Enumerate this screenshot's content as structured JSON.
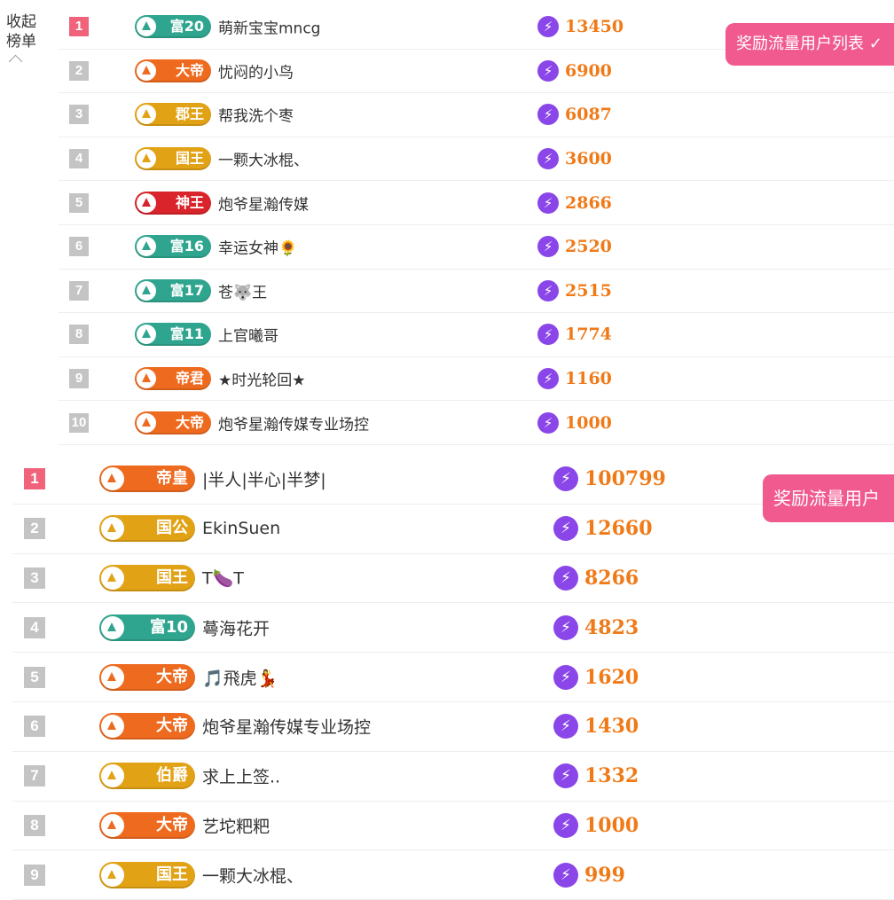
{
  "collapse": {
    "line1": "收起",
    "line2": "榜单"
  },
  "reward_buttons": [
    "奖励流量用户列表 ✓",
    "奖励流量用户"
  ],
  "list1": [
    {
      "rank": "1",
      "badge": "富20",
      "badge_color": "teal",
      "name": "萌新宝宝mncg",
      "score": "13450"
    },
    {
      "rank": "2",
      "badge": "大帝",
      "badge_color": "orange",
      "name": "忧闷的小鸟",
      "score": "6900"
    },
    {
      "rank": "3",
      "badge": "郡王",
      "badge_color": "gold",
      "name": "帮我洗个枣",
      "score": "6087"
    },
    {
      "rank": "4",
      "badge": "国王",
      "badge_color": "gold",
      "name": "一颗大冰棍、",
      "score": "3600"
    },
    {
      "rank": "5",
      "badge": "神王",
      "badge_color": "red",
      "name": "炮爷星瀚传媒",
      "score": "2866"
    },
    {
      "rank": "6",
      "badge": "富16",
      "badge_color": "teal",
      "name": "幸运女神🌻",
      "score": "2520"
    },
    {
      "rank": "7",
      "badge": "富17",
      "badge_color": "teal",
      "name": "苍🐺王",
      "score": "2515"
    },
    {
      "rank": "8",
      "badge": "富11",
      "badge_color": "teal",
      "name": "上官曦哥",
      "score": "1774"
    },
    {
      "rank": "9",
      "badge": "帝君",
      "badge_color": "orange",
      "name": "★时光轮回★",
      "score": "1160"
    },
    {
      "rank": "10",
      "badge": "大帝",
      "badge_color": "orange",
      "name": "炮爷星瀚传媒专业场控",
      "score": "1000"
    }
  ],
  "list2": [
    {
      "rank": "1",
      "badge": "帝皇",
      "badge_color": "orange",
      "name": "|半人|半心|半梦|",
      "score": "100799"
    },
    {
      "rank": "2",
      "badge": "国公",
      "badge_color": "gold",
      "name": "EkinSuen",
      "score": "12660"
    },
    {
      "rank": "3",
      "badge": "国王",
      "badge_color": "gold",
      "name": "T🍆T",
      "score": "8266"
    },
    {
      "rank": "4",
      "badge": "富10",
      "badge_color": "teal",
      "name": "蕚海花开",
      "score": "4823"
    },
    {
      "rank": "5",
      "badge": "大帝",
      "badge_color": "orange",
      "name": "🎵飛虎💃",
      "score": "1620"
    },
    {
      "rank": "6",
      "badge": "大帝",
      "badge_color": "orange",
      "name": "炮爷星瀚传媒专业场控",
      "score": "1430"
    },
    {
      "rank": "7",
      "badge": "伯爵",
      "badge_color": "gold",
      "name": "求上上签..",
      "score": "1332"
    },
    {
      "rank": "8",
      "badge": "大帝",
      "badge_color": "orange",
      "name": "艺坨粑粑",
      "score": "1000"
    },
    {
      "rank": "9",
      "badge": "国王",
      "badge_color": "gold",
      "name": "一颗大冰棍、",
      "score": "999"
    }
  ]
}
